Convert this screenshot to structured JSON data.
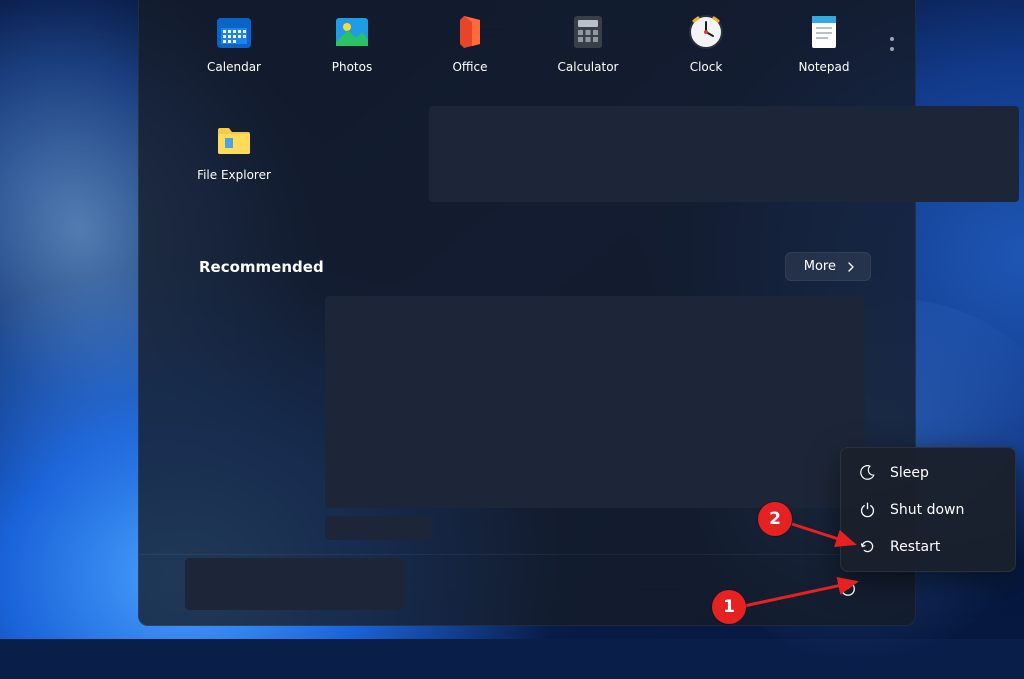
{
  "pinned_apps": [
    {
      "label": "Calendar",
      "icon": "calendar-icon"
    },
    {
      "label": "Photos",
      "icon": "photos-icon"
    },
    {
      "label": "Office",
      "icon": "office-icon"
    },
    {
      "label": "Calculator",
      "icon": "calculator-icon"
    },
    {
      "label": "Clock",
      "icon": "clock-icon"
    },
    {
      "label": "Notepad",
      "icon": "notepad-icon"
    },
    {
      "label": "File Explorer",
      "icon": "folder-icon"
    }
  ],
  "recommended": {
    "title": "Recommended",
    "more_label": "More"
  },
  "power_menu": {
    "items": [
      {
        "label": "Sleep",
        "icon": "moon-icon"
      },
      {
        "label": "Shut down",
        "icon": "power-icon"
      },
      {
        "label": "Restart",
        "icon": "restart-icon"
      }
    ]
  },
  "annotations": {
    "badge1": "1",
    "badge2": "2"
  }
}
